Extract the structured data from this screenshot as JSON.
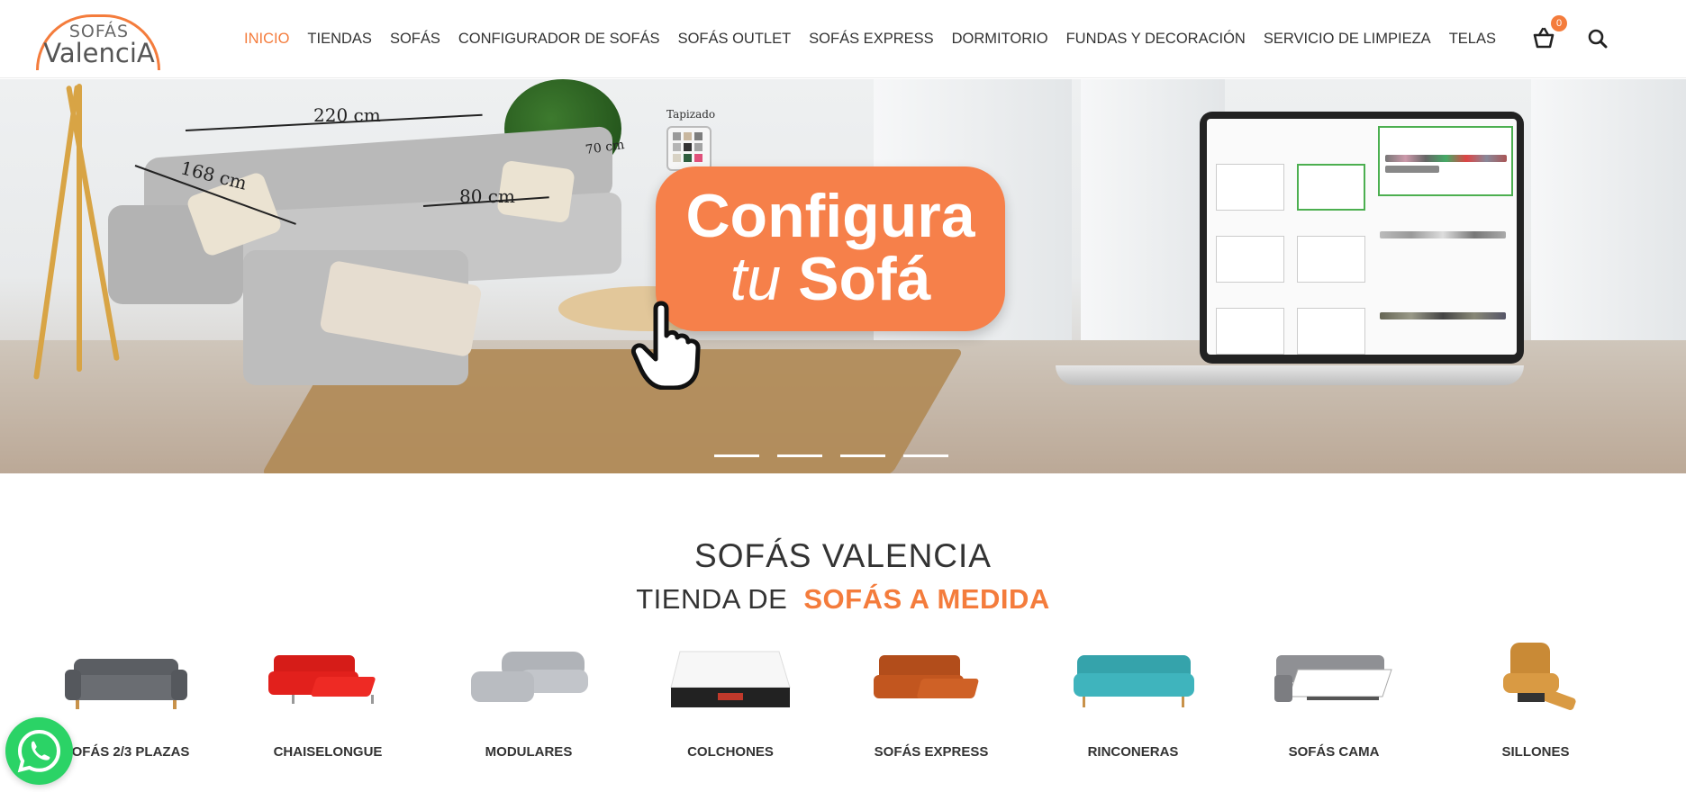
{
  "brand": {
    "logo_line1": "SOFÁS",
    "logo_line2": "ValenciA",
    "accent_color": "#f47c3c"
  },
  "nav": {
    "items": [
      {
        "label": "INICIO",
        "active": true
      },
      {
        "label": "TIENDAS"
      },
      {
        "label": "SOFÁS"
      },
      {
        "label": "CONFIGURADOR DE SOFÁS"
      },
      {
        "label": "SOFÁS OUTLET"
      },
      {
        "label": "SOFÁS EXPRESS"
      },
      {
        "label": "DORMITORIO"
      },
      {
        "label": "FUNDAS Y DECORACIÓN"
      },
      {
        "label": "SERVICIO DE LIMPIEZA"
      },
      {
        "label": "TELAS"
      }
    ]
  },
  "header_icons": {
    "cart_icon": "basket-icon",
    "cart_count": "0",
    "search_icon": "search-icon"
  },
  "hero": {
    "cta_line1": "Configura",
    "cta_line2_italic": "tu",
    "cta_line2_bold": "Sofá",
    "dims": [
      "220 cm",
      "168 cm",
      "80 cm",
      "70 cm"
    ],
    "swatch_label": "Tapizado",
    "slides_count": 4
  },
  "section": {
    "title": "SOFÁS VALENCIA",
    "subtitle_prefix": "TIENDA DE",
    "subtitle_accent": "SOFÁS A MEDIDA"
  },
  "categories": [
    {
      "label": "SOFÁS 2/3 PLAZAS",
      "color": "#5b5e63"
    },
    {
      "label": "CHAISELONGUE",
      "color": "#e2201c"
    },
    {
      "label": "MODULARES",
      "color": "#b9bcc1"
    },
    {
      "label": "COLCHONES",
      "color": "#f5f5f5"
    },
    {
      "label": "SOFÁS EXPRESS",
      "color": "#c2561f"
    },
    {
      "label": "RINCONERAS",
      "color": "#3fb4bd"
    },
    {
      "label": "SOFÁS CAMA",
      "color": "#8f9094"
    },
    {
      "label": "SILLONES",
      "color": "#d99a43"
    }
  ],
  "whatsapp": {
    "icon": "whatsapp-icon",
    "color": "#2bd366"
  }
}
